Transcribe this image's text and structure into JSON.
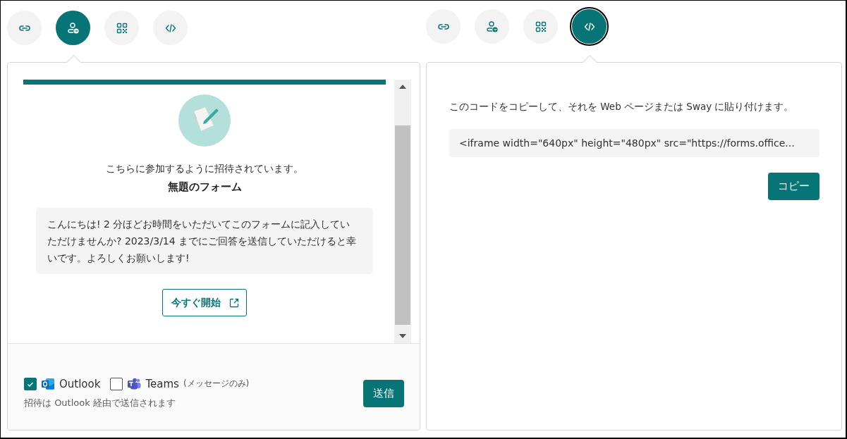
{
  "panels": [
    {
      "kind": "invite",
      "tabs": [
        {
          "kind": "link",
          "selected": false
        },
        {
          "kind": "invite",
          "selected": true
        },
        {
          "kind": "qr",
          "selected": false
        },
        {
          "kind": "embed",
          "selected": false
        }
      ],
      "preview": {
        "invite_text": "こちらに参加するように招待されています。",
        "form_title": "無題のフォーム",
        "message": "こんにちは! 2 分ほどお時間をいただいてこのフォームに記入していただけませんか? 2023/3/14 までにご回答を送信していただけると幸いです。よろしくお願いします!",
        "start_button": "今すぐ開始"
      },
      "channels": [
        {
          "kind": "outlook",
          "label": "Outlook",
          "checked": true
        },
        {
          "kind": "teams",
          "label": "Teams",
          "note": "(メッセージのみ)",
          "checked": false
        }
      ],
      "footer_note": "招待は Outlook 経由で送信されます",
      "send_button": "送信"
    },
    {
      "kind": "embed",
      "tabs": [
        {
          "kind": "link",
          "selected": false
        },
        {
          "kind": "invite",
          "selected": false
        },
        {
          "kind": "qr",
          "selected": false
        },
        {
          "kind": "embed",
          "selected": true
        }
      ],
      "description": "このコードをコピーして、それを Web ページまたは Sway に貼り付けます。",
      "code": "<iframe width=\"640px\" height=\"480px\" src=\"https://forms.office...",
      "copy_button": "コピー"
    }
  ]
}
